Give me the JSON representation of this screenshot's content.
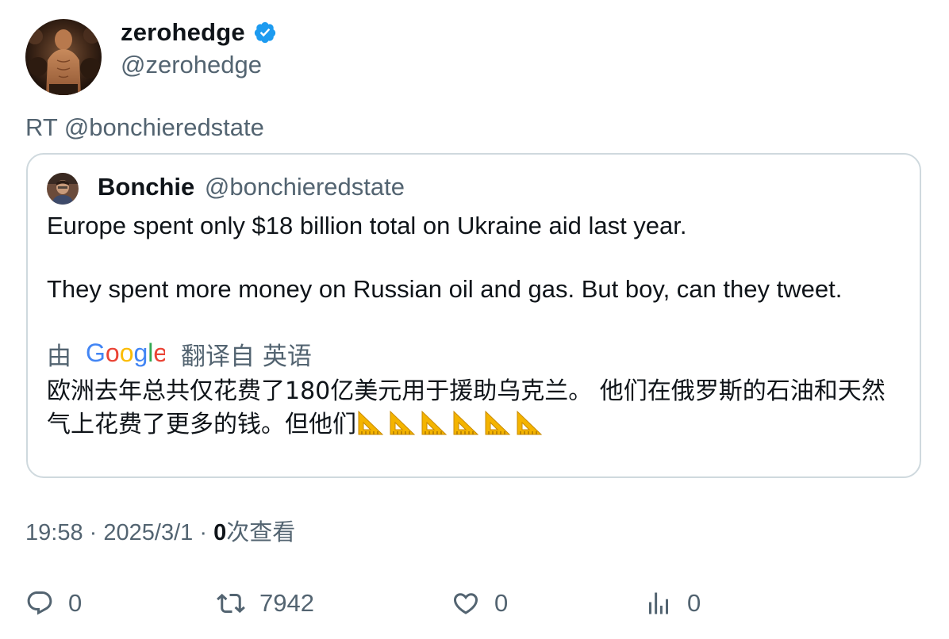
{
  "author": {
    "display_name": "zerohedge",
    "handle": "@zerohedge",
    "verified": true
  },
  "retweet_prefix": "RT @bonchieredstate",
  "quote": {
    "display_name": "Bonchie",
    "handle": "@bonchieredstate",
    "paragraph_1": "Europe spent only $18 billion total on Ukraine aid last year.",
    "paragraph_2": "They spent more money on Russian oil and gas. But boy, can they tweet.",
    "translation_by": "由",
    "translation_provider": "Google",
    "translation_from": "翻译自 英语",
    "translated_text": "欧洲去年总共仅花费了180亿美元用于援助乌克兰。 他们在俄罗斯的石油和天然气上花费了更多的钱。但他们",
    "emoji_count": 6
  },
  "meta": {
    "time": "19:58",
    "separator_1": "·",
    "date": "2025/3/1",
    "separator_2": "·",
    "views_count": "0",
    "views_label": "次查看"
  },
  "actions": {
    "replies": "0",
    "retweets": "7942",
    "likes": "0",
    "views": "0"
  },
  "colors": {
    "text_primary": "#0f1419",
    "text_secondary": "#536471",
    "border": "#cfd9de",
    "verified_blue": "#1d9bf0"
  }
}
